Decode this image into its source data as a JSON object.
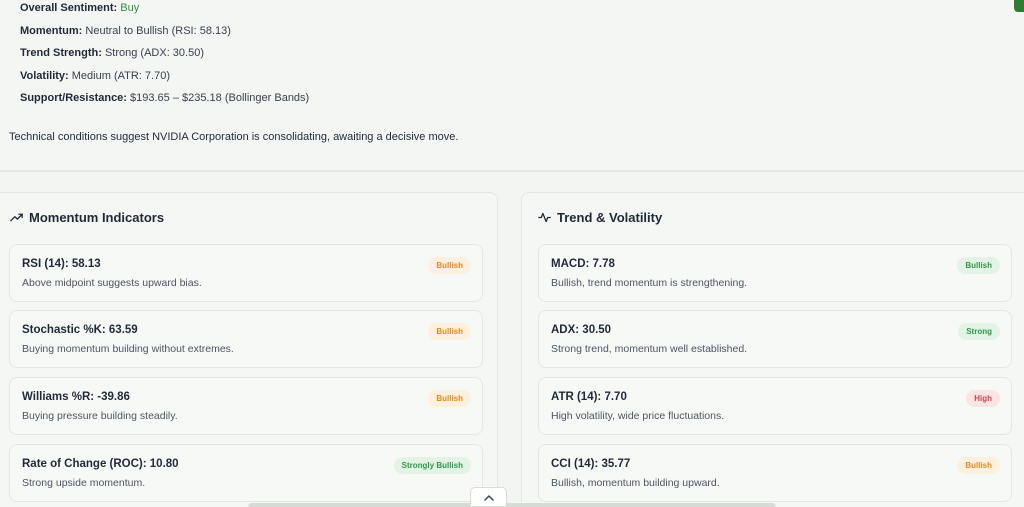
{
  "summary": {
    "sentiment_label": "Overall Sentiment:",
    "sentiment_value": "Buy",
    "momentum_label": "Momentum:",
    "momentum_value": "Neutral to Bullish (RSI: 58.13)",
    "trend_label": "Trend Strength:",
    "trend_value": "Strong (ADX: 30.50)",
    "volatility_label": "Volatility:",
    "volatility_value": "Medium (ATR: 7.70)",
    "sr_label": "Support/Resistance:",
    "sr_value": "$193.65 – $235.18 (Bollinger Bands)",
    "note": "Technical conditions suggest NVIDIA Corporation is consolidating, awaiting a decisive move."
  },
  "momentum_panel": {
    "title": "Momentum Indicators",
    "icon": "trending-up-icon",
    "cards": [
      {
        "title": "RSI (14): 58.13",
        "desc": "Above midpoint suggests upward bias.",
        "badge": "Bullish",
        "badge_color": "#e58a1f"
      },
      {
        "title": "Stochastic %K: 63.59",
        "desc": "Buying momentum building without extremes.",
        "badge": "Bullish",
        "badge_color": "#e58a1f"
      },
      {
        "title": "Williams %R: -39.86",
        "desc": "Buying pressure building steadily.",
        "badge": "Bullish",
        "badge_color": "#e58a1f"
      },
      {
        "title": "Rate of Change (ROC): 10.80",
        "desc": "Strong upside momentum.",
        "badge": "Strongly Bullish",
        "badge_color": "#2f9a4a"
      }
    ]
  },
  "trend_panel": {
    "title": "Trend & Volatility",
    "icon": "activity-icon",
    "cards": [
      {
        "title": "MACD: 7.78",
        "desc": "Bullish, trend momentum is strengthening.",
        "badge": "Bullish",
        "badge_color": "#2f9a4a"
      },
      {
        "title": "ADX: 30.50",
        "desc": "Strong trend, momentum well established.",
        "badge": "Strong",
        "badge_color": "#2f9a4a"
      },
      {
        "title": "ATR (14): 7.70",
        "desc": "High volatility, wide price fluctuations.",
        "badge": "High",
        "badge_color": "#d64545"
      },
      {
        "title": "CCI (14): 35.77",
        "desc": "Bullish, momentum building upward.",
        "badge": "Bullish",
        "badge_color": "#e58a1f"
      }
    ]
  },
  "collapse_icon": "chevron-up-icon",
  "colors": {
    "buy": "#2f8f46",
    "bullish_orange": "#e58a1f",
    "bullish_green": "#2f9a4a",
    "high_red": "#d64545"
  }
}
